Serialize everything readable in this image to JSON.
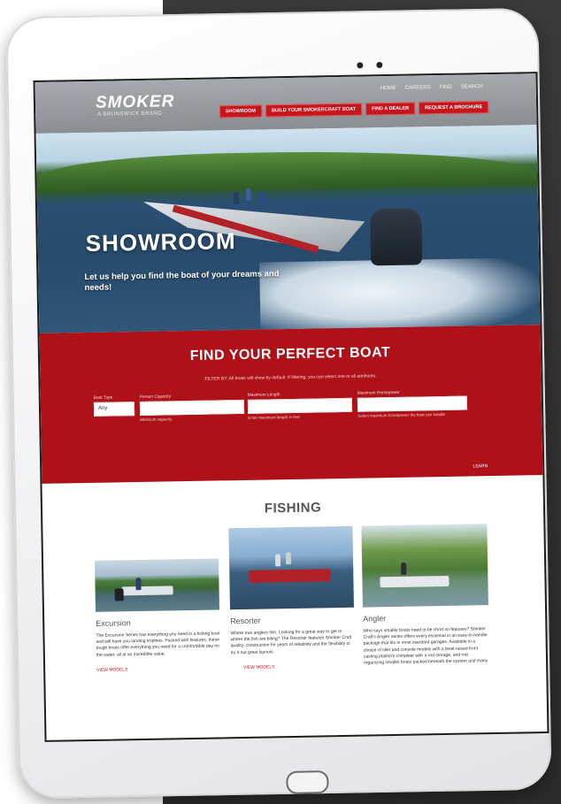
{
  "site": {
    "logo": "SMOKER",
    "logo_subtitle": "A BRUNSWICK BRAND",
    "top_links": [
      "HOME",
      "CAREERS",
      "FIND",
      "SEARCH"
    ],
    "nav_buttons": [
      "SHOWROOM",
      "BUILD YOUR SMOKERCRAFT BOAT",
      "FIND A DEALER",
      "REQUEST A BROCHURE"
    ]
  },
  "hero": {
    "title": "SHOWROOM",
    "subtitle": "Let us help you find the boat of your dreams and needs!"
  },
  "finder": {
    "title": "FIND YOUR PERFECT BOAT",
    "note": "FILTER BY: All boats will show by default. If filtering, you can select one or all attributes.",
    "fields": [
      {
        "label": "Boat Type",
        "value": "Any",
        "hint": ""
      },
      {
        "label": "Person Capacity",
        "value": "",
        "hint": "Minimum capacity"
      },
      {
        "label": "Maximum Length",
        "value": "",
        "hint": "Enter maximum length in feet"
      },
      {
        "label": "Maximum Horsepower",
        "value": "",
        "hint": "Select maximum horsepower the boat can handle"
      }
    ],
    "learn_more": "LEARN"
  },
  "fishing": {
    "title": "FISHING",
    "cards": [
      {
        "name": "Excursion",
        "desc": "The Excursion Series has everything you need in a fishing boat and will have you landing trophies. Packed with features, these tough boats offer everything you need for a comfortable day on the water, all at an incredible value.",
        "more": "VIEW MODELS"
      },
      {
        "name": "Resorter",
        "desc": "Where true anglers fish. Looking for a great way to get to where the fish are biting? The Resorter features Smoker Craft quality, construction for years of reliability and the flexibility to try it out great layouts.",
        "more": "VIEW MODELS"
      },
      {
        "name": "Angler",
        "desc": "Who says smaller boats need to be short on features? Smoker Craft's Angler series offers every essential in an easy-to-handle package that fits in most standard garages. Available in a choice of tiller and console models with a level-raised front casting platform complete with a rod storage, and rod organizing smaller boats packed beneath the system and many.",
        "more": ""
      }
    ]
  }
}
